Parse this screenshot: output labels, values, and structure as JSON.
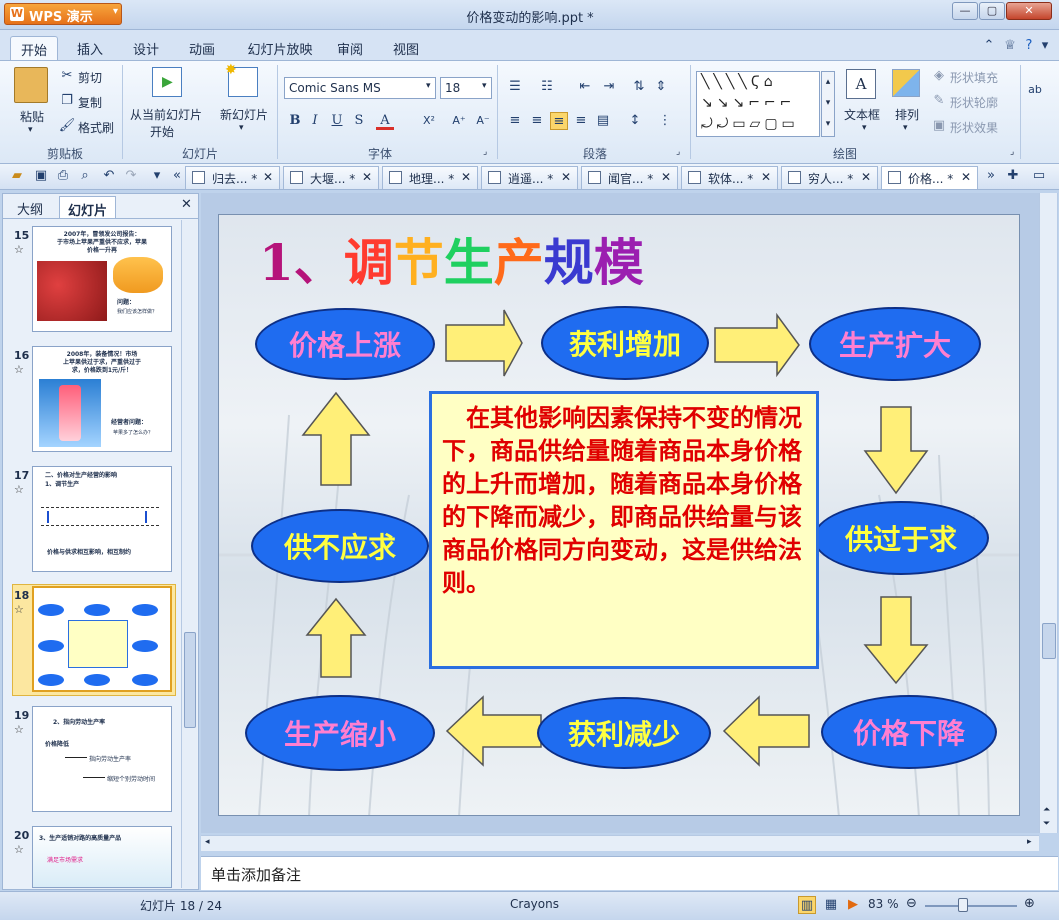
{
  "app": {
    "name": "WPS 演示",
    "window_title": "价格变动的影响.ppt *"
  },
  "ribbon_tabs": [
    "开始",
    "插入",
    "设计",
    "动画",
    "幻灯片放映",
    "审阅",
    "视图"
  ],
  "ribbon": {
    "clipboard": {
      "paste": "粘贴",
      "cut": "剪切",
      "copy": "复制",
      "format_painter": "格式刷",
      "group": "剪贴板"
    },
    "slides": {
      "from_current": "从当前幻灯片",
      "from_current_2": "开始",
      "new_slide": "新幻灯片",
      "group": "幻灯片"
    },
    "font": {
      "name": "Comic Sans MS",
      "size": "18",
      "group": "字体",
      "bold": "B",
      "italic": "I",
      "underline": "U",
      "shadow": "S",
      "color": "A",
      "superscript": "X²",
      "grow": "A⁺",
      "shrink": "A⁻"
    },
    "paragraph": {
      "group": "段落"
    },
    "drawing": {
      "textbox": "文本框",
      "arrange": "排列",
      "shape_fill": "形状填充",
      "shape_outline": "形状轮廓",
      "shape_effect": "形状效果",
      "group": "绘图"
    }
  },
  "doc_tabs": [
    "归去... *",
    "大堰... *",
    "地理... *",
    "逍遥... *",
    "闻官... *",
    "软体... *",
    "穷人... *",
    "价格... *"
  ],
  "left_pane": {
    "tabs": [
      "大纲",
      "幻灯片"
    ],
    "slides": [
      {
        "num": "15",
        "lines": [
          "2007年，冒领发公司报告：",
          "于市场上苹果严重供不应求，苹果",
          "价格一升再"
        ],
        "caption": "问题：",
        "caption2": "我们应该怎样做？"
      },
      {
        "num": "16",
        "lines": [
          "2008年，装备情况！市场",
          "上苹果供过于求，严重供过于",
          "求，价格跌到1元/斤！"
        ],
        "caption": "经营者问题：",
        "caption2": "苹果多了怎么办？"
      },
      {
        "num": "17",
        "lines": [
          "二、价格对生产经营的影响",
          "1、调节生产"
        ],
        "caption": "价格与供求相互影响，相互制约",
        "caption2": ""
      },
      {
        "num": "18",
        "lines": [],
        "caption": "",
        "caption2": ""
      },
      {
        "num": "19",
        "lines": [
          "2、指向劳动生产率",
          "价格降低"
        ],
        "caption": "指向劳动生产率",
        "caption2": "缩短个别劳动时间"
      },
      {
        "num": "20",
        "lines": [
          "3、生产适销对路的高质量产品"
        ],
        "caption": "满足市场需求",
        "caption2": ""
      }
    ]
  },
  "slide": {
    "title_prefix": "1、",
    "title_chars": [
      "调",
      "节",
      "生",
      "产",
      "规",
      "模"
    ],
    "title_colors": [
      "#ff3b2f",
      "#ffb020",
      "#1fd060",
      "#ff6a1a",
      "#3a3ad0",
      "#9b1fb0"
    ],
    "nodes": {
      "price_up": "价格上涨",
      "profit_up": "获利增加",
      "production_expand": "生产扩大",
      "supply_exceeds": "供过于求",
      "price_down": "价格下降",
      "profit_down": "获利减少",
      "production_shrink": "生产缩小",
      "supply_short": "供不应求"
    },
    "center_text": "　在其他影响因素保持不变的情况下，商品供给量随着商品本身价格的上升而增加，随着商品本身价格的下降而减少，即商品供给量与该商品价格同方向变动，这是供给法则。"
  },
  "notes_placeholder": "单击添加备注",
  "status": {
    "slide_count": "幻灯片 18 / 24",
    "theme": "Crayons",
    "zoom": "83 %"
  }
}
